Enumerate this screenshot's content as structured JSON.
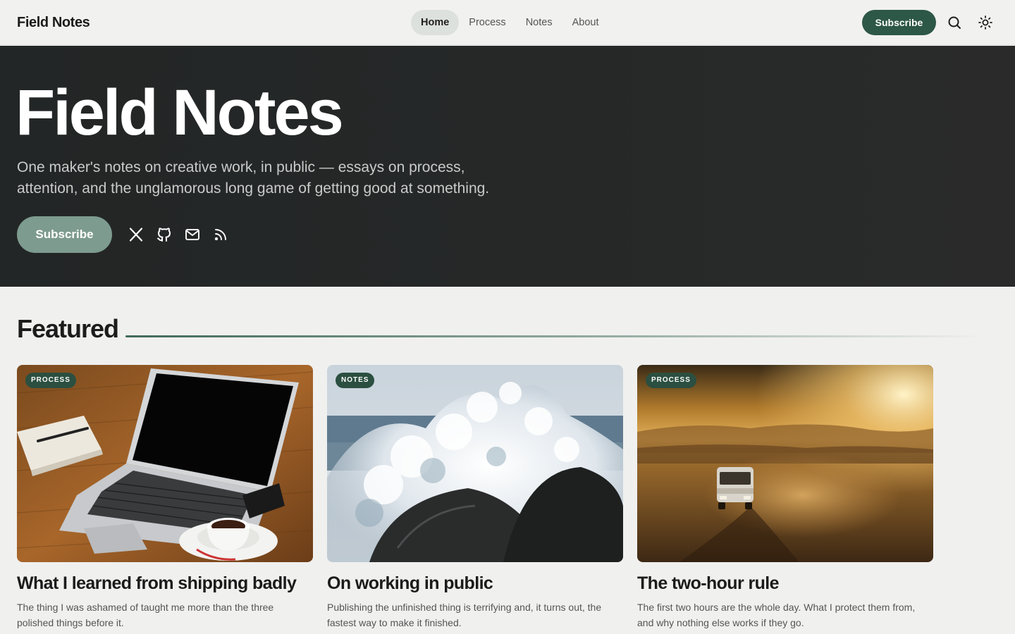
{
  "header": {
    "brand": "Field Notes",
    "nav": [
      {
        "label": "Home",
        "active": true
      },
      {
        "label": "Process",
        "active": false
      },
      {
        "label": "Notes",
        "active": false
      },
      {
        "label": "About",
        "active": false
      }
    ],
    "subscribe_label": "Subscribe",
    "icons": [
      "search-icon",
      "sun-icon"
    ]
  },
  "hero": {
    "title": "Field Notes",
    "description": "One maker's notes on creative work, in public — essays on process, attention, and the unglamorous long game of getting good at something.",
    "subscribe_label": "Subscribe",
    "social_icons": [
      "x-icon",
      "github-icon",
      "mail-icon",
      "rss-icon"
    ]
  },
  "featured": {
    "heading": "Featured",
    "cards": [
      {
        "tag": "PROCESS",
        "title": "What I learned from shipping badly",
        "excerpt": "The thing I was ashamed of taught me more than the three polished things before it.",
        "image": "laptop-coffee-desk"
      },
      {
        "tag": "NOTES",
        "title": "On working in public",
        "excerpt": "Publishing the unfinished thing is terrifying and, it turns out, the fastest way to make it finished.",
        "image": "wave-crashing-rocks"
      },
      {
        "tag": "PROCESS",
        "title": "The two-hour rule",
        "excerpt": "The first two hours are the whole day. What I protect them from, and why nothing else works if they go.",
        "image": "van-desert-sunset"
      }
    ]
  },
  "colors": {
    "accent": "#2d5746",
    "hero_button": "#7d9b8f",
    "hero_bg": "#252727",
    "page_bg": "#f0f0ef"
  }
}
